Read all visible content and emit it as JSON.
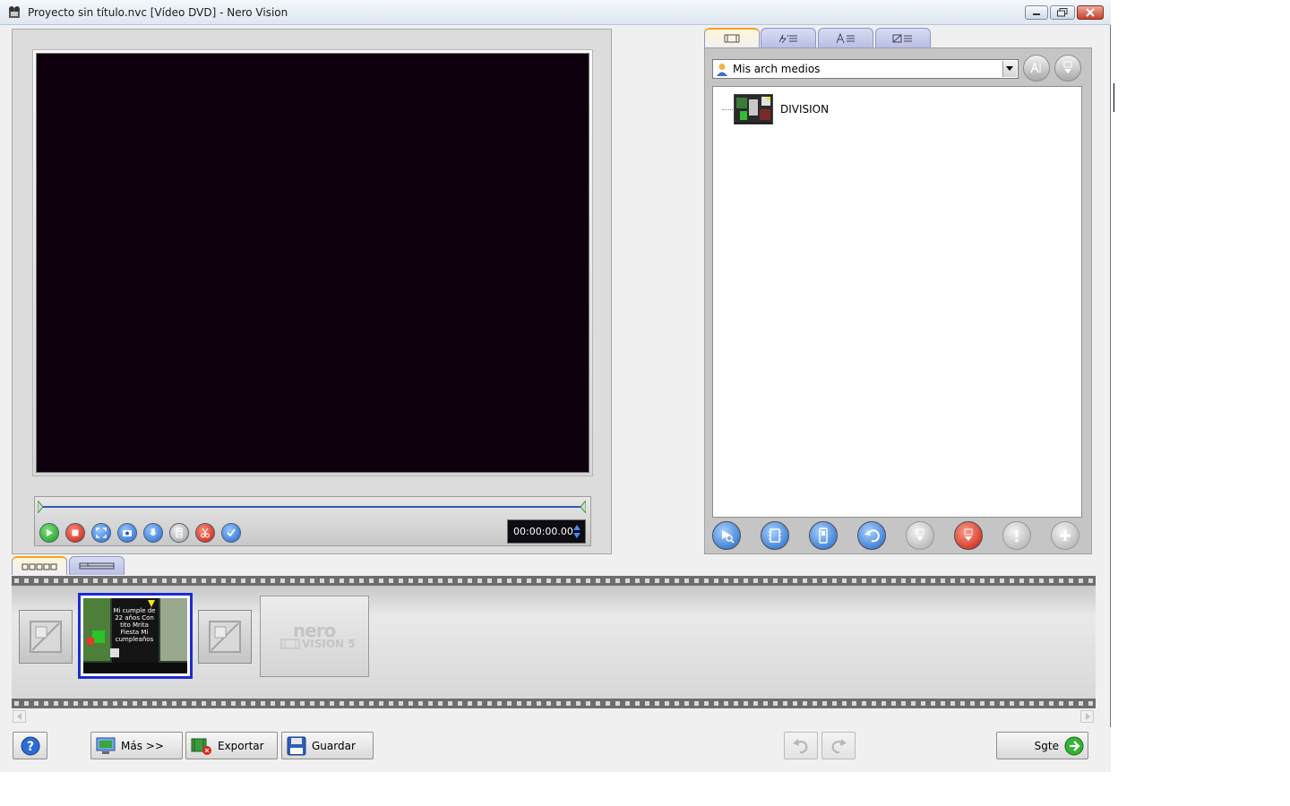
{
  "window": {
    "title": "Proyecto sin título.nvc [Vídeo DVD] - Nero Vision"
  },
  "preview": {
    "timecode": "00:00:00.00"
  },
  "library": {
    "dropdown_value": "Mis arch medios",
    "items": [
      {
        "label": "DIVISION"
      }
    ]
  },
  "storyboard": {
    "clip_caption": "Mi cumple de 22 años Con tito Mrita Fiesta Mi cumpleaños",
    "watermark_word": "nero",
    "watermark_sub": "VISION 5"
  },
  "bottom_bar": {
    "more_label": "Más >>",
    "export_label": "Exportar",
    "save_label": "Guardar",
    "next_label": "Sgte"
  },
  "colors": {
    "video_background": "#0e010d",
    "selection_border": "#1d2bd0",
    "tab_accent": "#f2a41e",
    "seek_track": "#2e59b7"
  }
}
